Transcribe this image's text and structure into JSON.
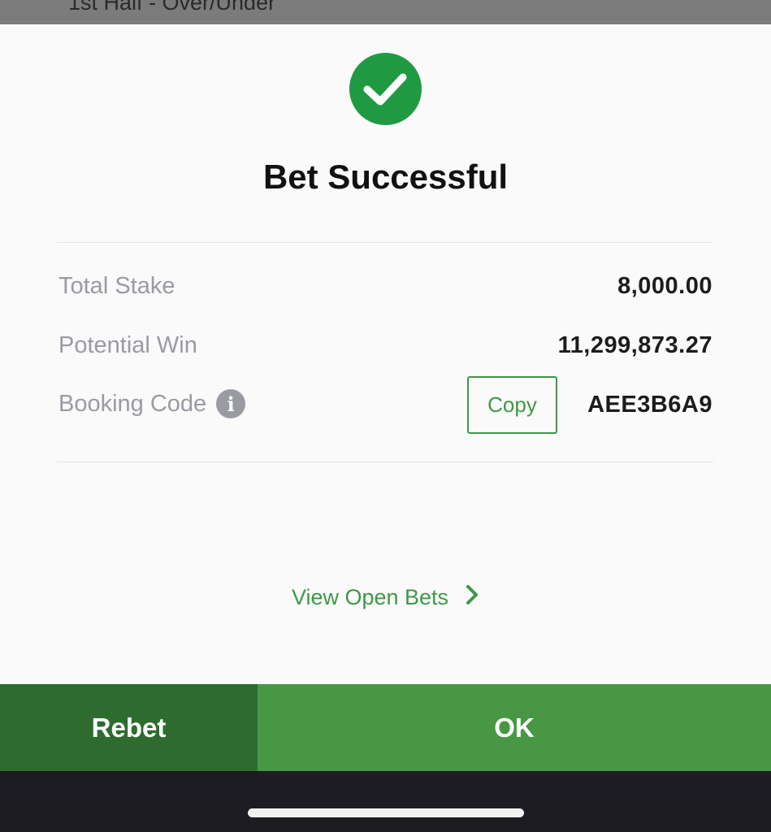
{
  "backdrop": {
    "text": "1st Half - Over/Under"
  },
  "dialog": {
    "status_icon": "check-icon",
    "title": "Bet Successful",
    "total_stake": {
      "label": "Total Stake",
      "value": "8,000.00"
    },
    "potential_win": {
      "label": "Potential Win",
      "value": "11,299,873.27"
    },
    "booking_code": {
      "label": "Booking Code",
      "info_icon": "i",
      "copy_label": "Copy",
      "value": "AEE3B6A9"
    },
    "view_open_bets": "View Open Bets"
  },
  "actions": {
    "rebet_label": "Rebet",
    "ok_label": "OK"
  },
  "colors": {
    "accent_green": "#3f9847",
    "success_green": "#1f9a43",
    "rebet_bg": "#2e6b2f",
    "ok_bg": "#489745"
  }
}
